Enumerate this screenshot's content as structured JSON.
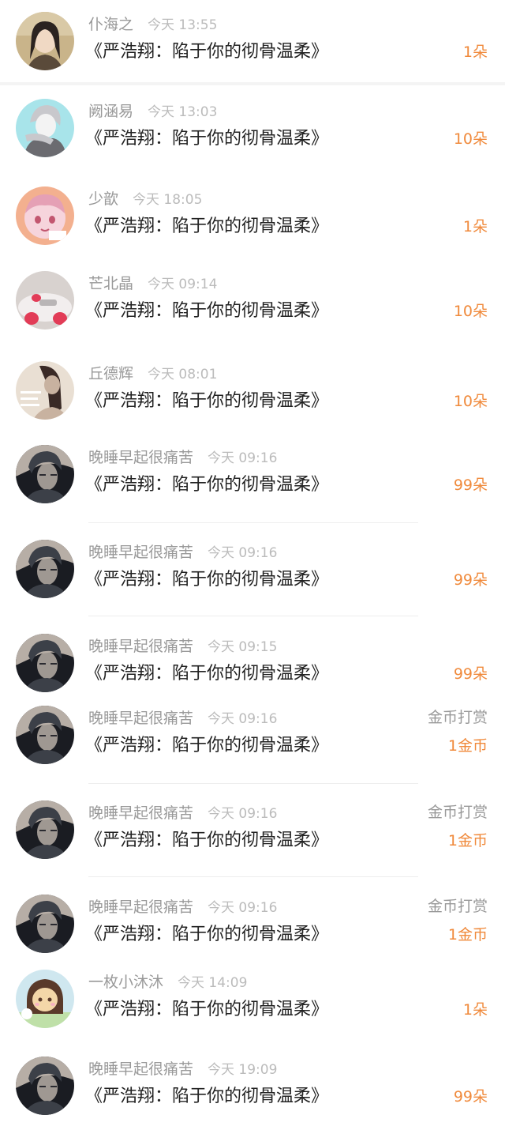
{
  "rows": [
    {
      "name": "仆海之",
      "time": "今天 13:55",
      "title": "《严浩翔：陷于你的彻骨温柔》",
      "gift": "1朵",
      "label": "",
      "avatar": "avatar-girl-outdoor",
      "colors": [
        "#c9b48a",
        "#5a4a3a",
        "#2b2320",
        "#f0d9c4"
      ]
    },
    {
      "name": "阙涵易",
      "time": "今天 13:03",
      "title": "《严浩翔：陷于你的彻骨温柔》",
      "gift": "10朵",
      "label": "",
      "avatar": "avatar-anime-boy-grey",
      "colors": [
        "#a8e4ea",
        "#c8c8cc",
        "#6b6b70",
        "#f3f3f3"
      ]
    },
    {
      "name": "少歆",
      "time": "今天 18:05",
      "title": "《严浩翔：陷于你的彻骨温柔》",
      "gift": "1朵",
      "label": "",
      "avatar": "avatar-anime-pink",
      "colors": [
        "#f3b08f",
        "#f6d4dc",
        "#e5a0b5",
        "#ffffff"
      ]
    },
    {
      "name": "芒北晶",
      "time": "今天 09:14",
      "title": "《严浩翔：陷于你的彻骨温柔》",
      "gift": "10朵",
      "label": "",
      "avatar": "avatar-hello-kitty-car",
      "colors": [
        "#d8d2cf",
        "#f2eeee",
        "#e23c57",
        "#8a8488"
      ]
    },
    {
      "name": "丘德辉",
      "time": "今天 08:01",
      "title": "《严浩翔：陷于你的彻骨温柔》",
      "gift": "10朵",
      "label": "",
      "avatar": "avatar-girl-text",
      "colors": [
        "#e9dfd3",
        "#3a2a26",
        "#c8b2a0",
        "#7a3a2a"
      ]
    },
    {
      "name": "晚睡早起很痛苦",
      "time": "今天 09:16",
      "title": "《严浩翔：陷于你的彻骨温柔》",
      "gift": "99朵",
      "label": "",
      "avatar": "avatar-dark-portrait",
      "colors": [
        "#1a1c22",
        "#3c4048",
        "#b7aea6",
        "#0c0d10"
      ]
    },
    {
      "name": "晚睡早起很痛苦",
      "time": "今天 09:16",
      "title": "《严浩翔：陷于你的彻骨温柔》",
      "gift": "99朵",
      "label": "",
      "avatar": "avatar-dark-portrait",
      "colors": [
        "#1a1c22",
        "#3c4048",
        "#b7aea6",
        "#0c0d10"
      ]
    },
    {
      "name": "晚睡早起很痛苦",
      "time": "今天 09:15",
      "title": "《严浩翔：陷于你的彻骨温柔》",
      "gift": "99朵",
      "label": "",
      "avatar": "avatar-dark-portrait",
      "colors": [
        "#1a1c22",
        "#3c4048",
        "#b7aea6",
        "#0c0d10"
      ]
    },
    {
      "name": "晚睡早起很痛苦",
      "time": "今天 09:16",
      "title": "《严浩翔：陷于你的彻骨温柔》",
      "gift": "1金币",
      "label": "金币打赏",
      "avatar": "avatar-dark-portrait",
      "colors": [
        "#1a1c22",
        "#3c4048",
        "#b7aea6",
        "#0c0d10"
      ]
    },
    {
      "name": "晚睡早起很痛苦",
      "time": "今天 09:16",
      "title": "《严浩翔：陷于你的彻骨温柔》",
      "gift": "1金币",
      "label": "金币打赏",
      "avatar": "avatar-dark-portrait",
      "colors": [
        "#1a1c22",
        "#3c4048",
        "#b7aea6",
        "#0c0d10"
      ]
    },
    {
      "name": "晚睡早起很痛苦",
      "time": "今天 09:16",
      "title": "《严浩翔：陷于你的彻骨温柔》",
      "gift": "1金币",
      "label": "金币打赏",
      "avatar": "avatar-dark-portrait",
      "colors": [
        "#1a1c22",
        "#3c4048",
        "#b7aea6",
        "#0c0d10"
      ]
    },
    {
      "name": "一枚小沐沐",
      "time": "今天 14:09",
      "title": "《严浩翔：陷于你的彻骨温柔》",
      "gift": "1朵",
      "label": "",
      "avatar": "avatar-cartoon-girl",
      "colors": [
        "#cfe7ef",
        "#f4d7a8",
        "#5a3a2a",
        "#f6b3c0"
      ]
    },
    {
      "name": "晚睡早起很痛苦",
      "time": "今天 19:09",
      "title": "《严浩翔：陷于你的彻骨温柔》",
      "gift": "99朵",
      "label": "",
      "avatar": "avatar-dark-portrait",
      "colors": [
        "#1a1c22",
        "#3c4048",
        "#b7aea6",
        "#0c0d10"
      ]
    }
  ],
  "theme": {
    "accent": "#f08a3c",
    "muted": "#999999",
    "text": "#222222",
    "background": "#f4f4f4"
  }
}
